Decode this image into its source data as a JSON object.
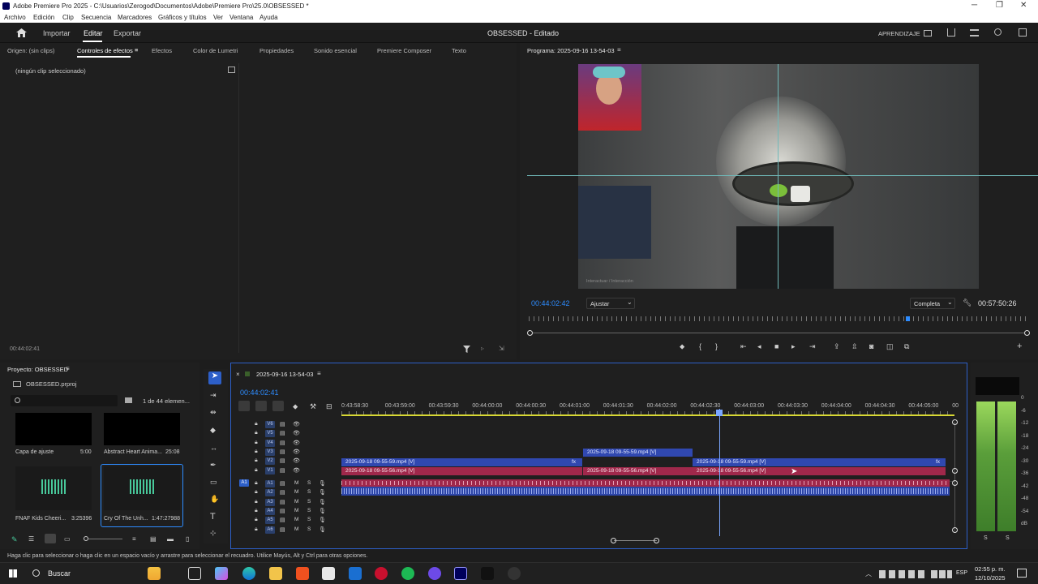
{
  "window": {
    "title": "Adobe Premiere Pro 2025 - C:\\Usuarios\\Zerogod\\Documentos\\Adobe\\Premiere Pro\\25.0\\OBSESSED *",
    "minimize": "─",
    "maximize": "❐",
    "close": "✕"
  },
  "menu": [
    "Archivo",
    "Edición",
    "Clip",
    "Secuencia",
    "Marcadores",
    "Gráficos y títulos",
    "Ver",
    "Ventana",
    "Ayuda"
  ],
  "header": {
    "import": "Importar",
    "edit": "Editar",
    "export": "Exportar",
    "project_status": "OBSESSED - Editado",
    "learn": "APRENDIZAJE"
  },
  "source_panel": {
    "tabs": [
      "Origen: (sin clips)",
      "Controles de efectos",
      "Efectos",
      "Color de Lumetri",
      "Propiedades",
      "Sonido esencial",
      "Premiere Composer",
      "Texto"
    ],
    "empty_msg": "(ningún clip seleccionado)",
    "timecode": "00:44:02:41"
  },
  "program_panel": {
    "title": "Programa: 2025-09-16 13-54-03",
    "timecode": "00:44:02:42",
    "fit": "Ajustar",
    "quality": "Completa",
    "duration": "00:57:50:26",
    "watermark": "Interactuar / Interacción"
  },
  "project_panel": {
    "title": "Proyecto: OBSESSED",
    "file": "OBSESSED.prproj",
    "count": "1 de 44 elemen...",
    "items": [
      {
        "name": "Capa de ajuste",
        "duration": "5:00"
      },
      {
        "name": "Abstract Heart Anima...",
        "duration": "25:08"
      },
      {
        "name": "FNAF Kids Cheeri...",
        "duration": "3:25396"
      },
      {
        "name": "Cry Of The Unh...",
        "duration": "1:47:27988"
      }
    ]
  },
  "timeline": {
    "sequence": "2025-09-16 13-54-03",
    "timecode": "00:44:02:41",
    "ruler": [
      "0:43:58:30",
      "00:43:59:00",
      "00:43:59:30",
      "00:44:00:00",
      "00:44:00:30",
      "00:44:01:00",
      "00:44:01:30",
      "00:44:02:00",
      "00:44:02:30",
      "00:44:03:00",
      "00:44:03:30",
      "00:44:04:00",
      "00:44:04:30",
      "00:44:05:00",
      "00"
    ],
    "video_tracks": [
      "V6",
      "V5",
      "V4",
      "V3",
      "V2",
      "V1"
    ],
    "audio_tracks": [
      "A1",
      "A2",
      "A3",
      "A4",
      "A5",
      "A6"
    ],
    "source_patch": "A1",
    "track_m": "M",
    "track_s": "S",
    "clips": {
      "v3": "2025-09-18 09-55-59.mp4 [V]",
      "v2a": "2025-09-18 09-55-59.mp4 [V]",
      "v2b": "2025-09-18 09-55-59.mp4 [V]",
      "v1a": "2025-09-18 09-55-56.mp4 [V]",
      "v1b": "2025-09-18 09-55-56.mp4 [V]",
      "v1c": "2025-09-18 09-55-56.mp4 [V]",
      "fx": "fx"
    }
  },
  "meter": {
    "labels": [
      "0",
      "-6",
      "-12",
      "-18",
      "-24",
      "-30",
      "-36",
      "-42",
      "-48",
      "-54",
      "dB"
    ],
    "solo": [
      "S",
      "S"
    ]
  },
  "status_bar": "Haga clic para seleccionar o haga clic en un espacio vacío y arrastre para seleccionar el recuadro. Utilice Mayús, Alt y Ctrl para otras opciones.",
  "taskbar": {
    "search": "Buscar",
    "lang": "ESP",
    "time": "02:55 p. m.",
    "date": "12/10/2025"
  },
  "colors": {
    "accent": "#2d8cff",
    "clip_video": "#3048b0",
    "clip_pink": "#a0284b",
    "playhead": "#7aa7ff"
  }
}
